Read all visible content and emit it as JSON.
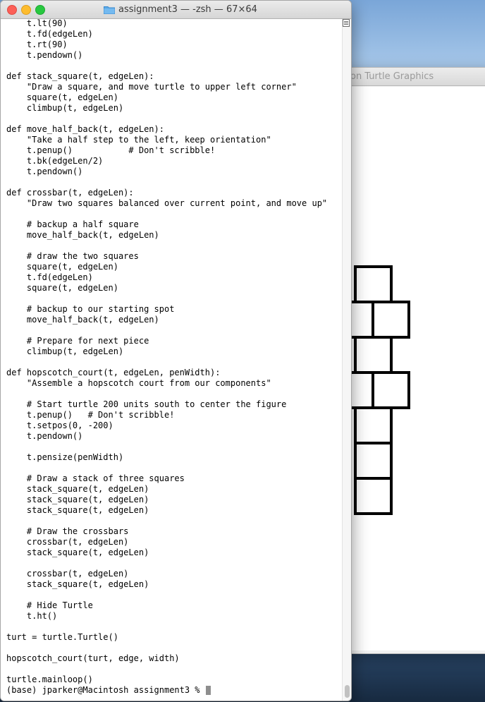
{
  "turtle_window": {
    "title": "on Turtle Graphics"
  },
  "terminal": {
    "title": "assignment3 — -zsh — 67×64",
    "lines": [
      "    t.lt(90)",
      "    t.fd(edgeLen)",
      "    t.rt(90)",
      "    t.pendown()",
      "",
      "def stack_square(t, edgeLen):",
      "    \"Draw a square, and move turtle to upper left corner\"",
      "    square(t, edgeLen)",
      "    climbup(t, edgeLen)",
      "",
      "def move_half_back(t, edgeLen):",
      "    \"Take a half step to the left, keep orientation\"",
      "    t.penup()           # Don't scribble!",
      "    t.bk(edgeLen/2)",
      "    t.pendown()",
      "",
      "def crossbar(t, edgeLen):",
      "    \"Draw two squares balanced over current point, and move up\"",
      "",
      "    # backup a half square",
      "    move_half_back(t, edgeLen)",
      "",
      "    # draw the two squares",
      "    square(t, edgeLen)",
      "    t.fd(edgeLen)",
      "    square(t, edgeLen)",
      "",
      "    # backup to our starting spot",
      "    move_half_back(t, edgeLen)",
      "",
      "    # Prepare for next piece",
      "    climbup(t, edgeLen)",
      "",
      "def hopscotch_court(t, edgeLen, penWidth):",
      "    \"Assemble a hopscotch court from our components\"",
      "",
      "    # Start turtle 200 units south to center the figure",
      "    t.penup()   # Don't scribble!",
      "    t.setpos(0, -200)",
      "    t.pendown()",
      "",
      "    t.pensize(penWidth)",
      "",
      "    # Draw a stack of three squares",
      "    stack_square(t, edgeLen)",
      "    stack_square(t, edgeLen)",
      "    stack_square(t, edgeLen)",
      "",
      "    # Draw the crossbars",
      "    crossbar(t, edgeLen)",
      "    stack_square(t, edgeLen)",
      "",
      "    crossbar(t, edgeLen)",
      "    stack_square(t, edgeLen)",
      "",
      "    # Hide Turtle",
      "    t.ht()",
      "",
      "turt = turtle.Turtle()",
      "",
      "hopscotch_court(turt, edge, width)",
      "",
      "turtle.mainloop()"
    ],
    "prompt": "(base) jparker@Macintosh assignment3 % "
  },
  "colors": {
    "close": "#fc5f57",
    "minimize": "#fdbc2e",
    "maximize": "#28c840",
    "folder": "#5aa9e6"
  }
}
